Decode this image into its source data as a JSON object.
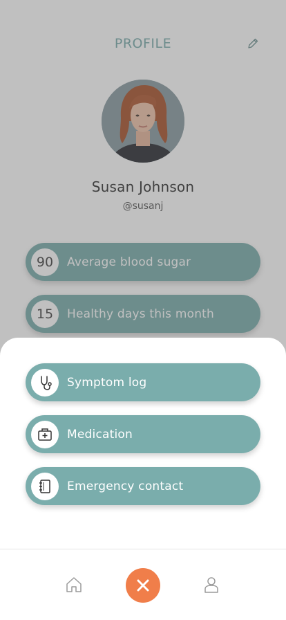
{
  "header": {
    "title": "PROFILE",
    "edit_icon": "pencil-icon"
  },
  "user": {
    "name": "Susan Johnson",
    "handle": "@susanj"
  },
  "stats": [
    {
      "value": "90",
      "label": "Average blood sugar"
    },
    {
      "value": "15",
      "label": "Healthy days this month"
    }
  ],
  "menu": [
    {
      "icon": "stethoscope-icon",
      "label": "Symptom log"
    },
    {
      "icon": "medical-bag-icon",
      "label": "Medication"
    },
    {
      "icon": "address-book-icon",
      "label": "Emergency contact"
    }
  ],
  "nav": {
    "home_icon": "home-icon",
    "close_icon": "close-icon",
    "profile_icon": "user-icon"
  },
  "colors": {
    "accent": "#7aadac",
    "close_button": "#f07e4a",
    "header_text": "#7aabab"
  }
}
